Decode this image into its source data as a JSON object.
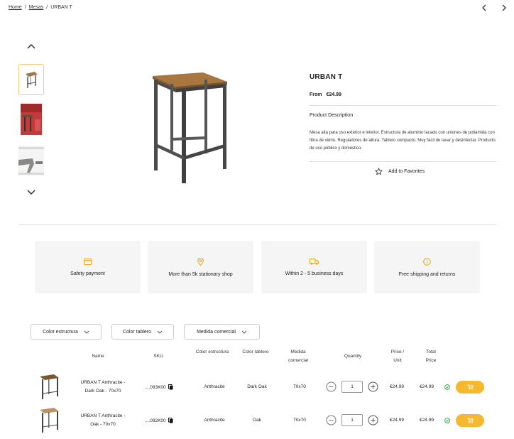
{
  "breadcrumb": {
    "home": "Home",
    "sep1": "/",
    "category": "Mesas",
    "sep2": "/",
    "current": "URBAN T"
  },
  "product": {
    "title": "URBAN T",
    "price_from": "From",
    "price": "€24.99",
    "description_title": "Product Description",
    "description": "Mesa alta para uso exterior e interior. Estructura de aluminio lacado con uniones de poliamida con fibra de vidrio. Reguladores de altura. Tablero compacto. Muy fácil de lavar y desinfectar. Producto de uso público y doméstico.",
    "favorites": "Add to Favorites"
  },
  "features": [
    {
      "icon": "credit-card-icon",
      "label": "Safety payment"
    },
    {
      "icon": "map-pin-icon",
      "label": "More than 5k stationary shop"
    },
    {
      "icon": "truck-icon",
      "label": "Within 2 - 5 business days"
    },
    {
      "icon": "info-icon",
      "label": "Free shipping and returns"
    }
  ],
  "filters": [
    "Color estructura",
    "Color tablero",
    "Medida comercial"
  ],
  "table": {
    "headers": {
      "name": "Name",
      "sku": "SKU",
      "color_structure": "Color estructura",
      "color_top": "Color tablero",
      "size_l1": "Medida",
      "size_l2": "comercial",
      "quantity": "Quantity",
      "price_l1": "Price /",
      "price_l2": "Unit",
      "total_l1": "Total",
      "total_l2": "Price"
    },
    "rows": [
      {
        "name_l1": "URBAN T Anthracite -",
        "name_l2": "Dark Oak - 70x70",
        "sku": "....093K00",
        "color_structure": "Anthracite",
        "color_top": "Dark Oak",
        "size": "70x70",
        "qty": "1",
        "unit_price": "€24.99",
        "total_price": "€24.99"
      },
      {
        "name_l1": "URBAN T Anthracite -",
        "name_l2": "Oak - 70x70",
        "sku": "....092K00",
        "color_structure": "Anthracite",
        "color_top": "Oak",
        "size": "70x70",
        "qty": "1",
        "unit_price": "€24.99",
        "total_price": "€24.99"
      }
    ]
  },
  "colors": {
    "accent": "#f5b82e",
    "highlight": "#f5c77a",
    "success": "#3aa655"
  }
}
